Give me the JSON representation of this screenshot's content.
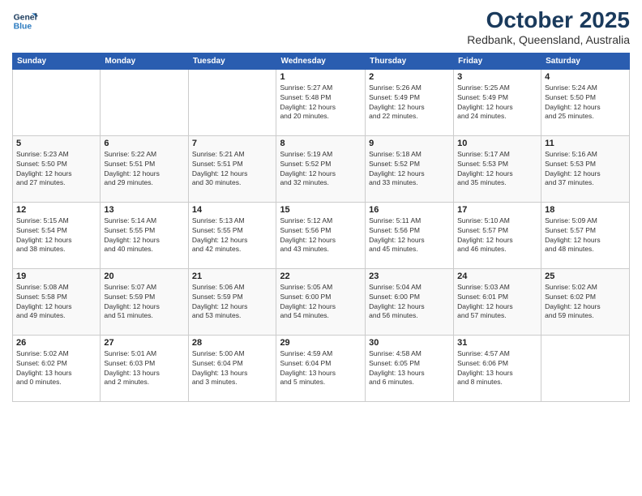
{
  "header": {
    "logo_line1": "General",
    "logo_line2": "Blue",
    "month": "October 2025",
    "location": "Redbank, Queensland, Australia"
  },
  "weekdays": [
    "Sunday",
    "Monday",
    "Tuesday",
    "Wednesday",
    "Thursday",
    "Friday",
    "Saturday"
  ],
  "weeks": [
    [
      {
        "day": "",
        "info": ""
      },
      {
        "day": "",
        "info": ""
      },
      {
        "day": "",
        "info": ""
      },
      {
        "day": "1",
        "info": "Sunrise: 5:27 AM\nSunset: 5:48 PM\nDaylight: 12 hours\nand 20 minutes."
      },
      {
        "day": "2",
        "info": "Sunrise: 5:26 AM\nSunset: 5:49 PM\nDaylight: 12 hours\nand 22 minutes."
      },
      {
        "day": "3",
        "info": "Sunrise: 5:25 AM\nSunset: 5:49 PM\nDaylight: 12 hours\nand 24 minutes."
      },
      {
        "day": "4",
        "info": "Sunrise: 5:24 AM\nSunset: 5:50 PM\nDaylight: 12 hours\nand 25 minutes."
      }
    ],
    [
      {
        "day": "5",
        "info": "Sunrise: 5:23 AM\nSunset: 5:50 PM\nDaylight: 12 hours\nand 27 minutes."
      },
      {
        "day": "6",
        "info": "Sunrise: 5:22 AM\nSunset: 5:51 PM\nDaylight: 12 hours\nand 29 minutes."
      },
      {
        "day": "7",
        "info": "Sunrise: 5:21 AM\nSunset: 5:51 PM\nDaylight: 12 hours\nand 30 minutes."
      },
      {
        "day": "8",
        "info": "Sunrise: 5:19 AM\nSunset: 5:52 PM\nDaylight: 12 hours\nand 32 minutes."
      },
      {
        "day": "9",
        "info": "Sunrise: 5:18 AM\nSunset: 5:52 PM\nDaylight: 12 hours\nand 33 minutes."
      },
      {
        "day": "10",
        "info": "Sunrise: 5:17 AM\nSunset: 5:53 PM\nDaylight: 12 hours\nand 35 minutes."
      },
      {
        "day": "11",
        "info": "Sunrise: 5:16 AM\nSunset: 5:53 PM\nDaylight: 12 hours\nand 37 minutes."
      }
    ],
    [
      {
        "day": "12",
        "info": "Sunrise: 5:15 AM\nSunset: 5:54 PM\nDaylight: 12 hours\nand 38 minutes."
      },
      {
        "day": "13",
        "info": "Sunrise: 5:14 AM\nSunset: 5:55 PM\nDaylight: 12 hours\nand 40 minutes."
      },
      {
        "day": "14",
        "info": "Sunrise: 5:13 AM\nSunset: 5:55 PM\nDaylight: 12 hours\nand 42 minutes."
      },
      {
        "day": "15",
        "info": "Sunrise: 5:12 AM\nSunset: 5:56 PM\nDaylight: 12 hours\nand 43 minutes."
      },
      {
        "day": "16",
        "info": "Sunrise: 5:11 AM\nSunset: 5:56 PM\nDaylight: 12 hours\nand 45 minutes."
      },
      {
        "day": "17",
        "info": "Sunrise: 5:10 AM\nSunset: 5:57 PM\nDaylight: 12 hours\nand 46 minutes."
      },
      {
        "day": "18",
        "info": "Sunrise: 5:09 AM\nSunset: 5:57 PM\nDaylight: 12 hours\nand 48 minutes."
      }
    ],
    [
      {
        "day": "19",
        "info": "Sunrise: 5:08 AM\nSunset: 5:58 PM\nDaylight: 12 hours\nand 49 minutes."
      },
      {
        "day": "20",
        "info": "Sunrise: 5:07 AM\nSunset: 5:59 PM\nDaylight: 12 hours\nand 51 minutes."
      },
      {
        "day": "21",
        "info": "Sunrise: 5:06 AM\nSunset: 5:59 PM\nDaylight: 12 hours\nand 53 minutes."
      },
      {
        "day": "22",
        "info": "Sunrise: 5:05 AM\nSunset: 6:00 PM\nDaylight: 12 hours\nand 54 minutes."
      },
      {
        "day": "23",
        "info": "Sunrise: 5:04 AM\nSunset: 6:00 PM\nDaylight: 12 hours\nand 56 minutes."
      },
      {
        "day": "24",
        "info": "Sunrise: 5:03 AM\nSunset: 6:01 PM\nDaylight: 12 hours\nand 57 minutes."
      },
      {
        "day": "25",
        "info": "Sunrise: 5:02 AM\nSunset: 6:02 PM\nDaylight: 12 hours\nand 59 minutes."
      }
    ],
    [
      {
        "day": "26",
        "info": "Sunrise: 5:02 AM\nSunset: 6:02 PM\nDaylight: 13 hours\nand 0 minutes."
      },
      {
        "day": "27",
        "info": "Sunrise: 5:01 AM\nSunset: 6:03 PM\nDaylight: 13 hours\nand 2 minutes."
      },
      {
        "day": "28",
        "info": "Sunrise: 5:00 AM\nSunset: 6:04 PM\nDaylight: 13 hours\nand 3 minutes."
      },
      {
        "day": "29",
        "info": "Sunrise: 4:59 AM\nSunset: 6:04 PM\nDaylight: 13 hours\nand 5 minutes."
      },
      {
        "day": "30",
        "info": "Sunrise: 4:58 AM\nSunset: 6:05 PM\nDaylight: 13 hours\nand 6 minutes."
      },
      {
        "day": "31",
        "info": "Sunrise: 4:57 AM\nSunset: 6:06 PM\nDaylight: 13 hours\nand 8 minutes."
      },
      {
        "day": "",
        "info": ""
      }
    ]
  ]
}
